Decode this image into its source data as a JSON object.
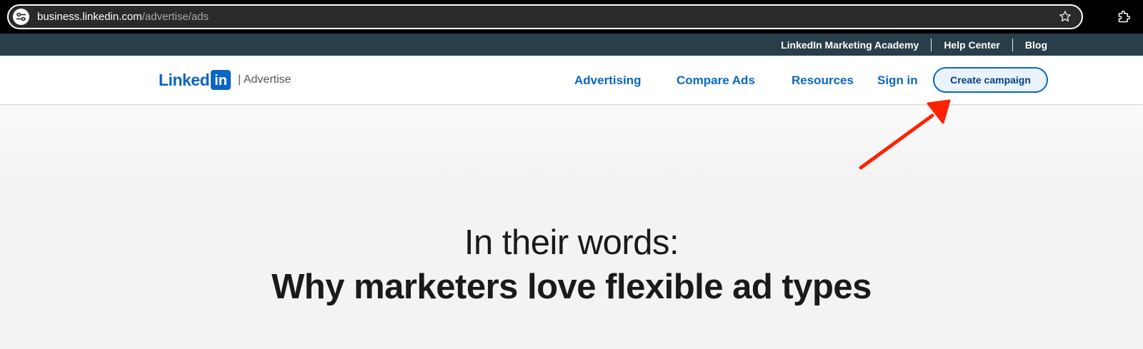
{
  "browser": {
    "url_domain": "business.linkedin.com",
    "url_path": "/advertise/ads",
    "icons": [
      "site-info-icon",
      "star-icon",
      "extensions-icon"
    ]
  },
  "utility_nav": {
    "links": [
      "LinkedIn Marketing Academy",
      "Help Center",
      "Blog"
    ]
  },
  "header": {
    "logo_text": "Linked",
    "logo_badge": "in",
    "logo_subtitle": "| Advertise",
    "nav": {
      "advertising": "Advertising",
      "compare_ads": "Compare Ads",
      "resources": "Resources",
      "sign_in": "Sign in"
    },
    "cta_label": "Create campaign"
  },
  "hero": {
    "line1": "In their words:",
    "line2": "Why marketers love flexible ad types"
  },
  "colors": {
    "brand_blue": "#0a66c2",
    "utility_bar": "#283e4a",
    "annotation_red": "#ff2200"
  }
}
